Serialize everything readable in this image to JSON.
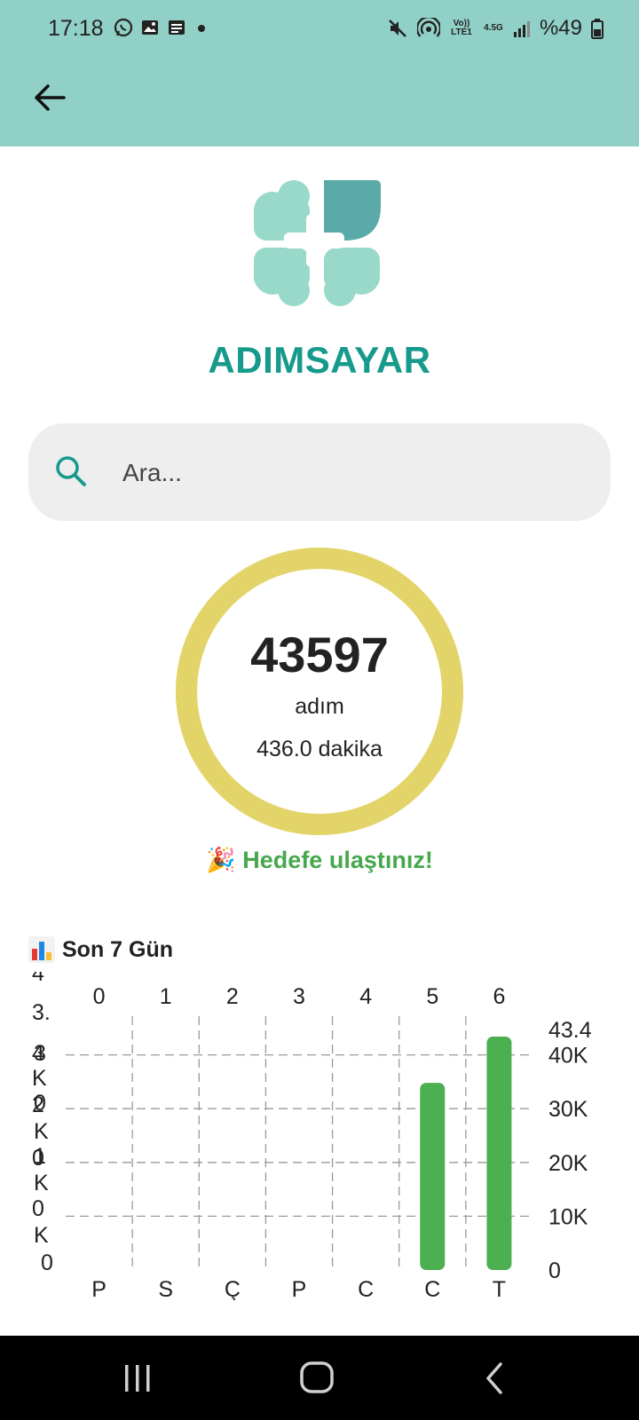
{
  "status_bar": {
    "time": "17:18",
    "left_icons": [
      "whatsapp-icon",
      "gallery-icon",
      "message-icon",
      "dot-icon"
    ],
    "right_icons": [
      "mute-icon",
      "hotspot-icon",
      "volte-icon",
      "signal-icon"
    ],
    "volte_label": "Vo)) LTE1",
    "network_label": "4.5G",
    "battery": "%49"
  },
  "app": {
    "title": "ADIMSAYAR",
    "brand_color": "#169a8c"
  },
  "search": {
    "placeholder": "Ara..."
  },
  "progress": {
    "steps": "43597",
    "unit": "adım",
    "minutes": "436.0 dakika",
    "ring_color": "#e3d46a",
    "goal_fraction": 1.0,
    "goal_message": "🎉 Hedefe ulaştınız!"
  },
  "weekly": {
    "title": "Son 7 Gün"
  },
  "chart_data": {
    "type": "bar",
    "categories": [
      "P",
      "S",
      "Ç",
      "P",
      "C",
      "C",
      "T"
    ],
    "top_labels": [
      "0",
      "1",
      "2",
      "3",
      "4",
      "5",
      "6"
    ],
    "values": [
      0,
      0,
      0,
      0,
      0,
      34800,
      43400
    ],
    "right_ticks": [
      "43.4",
      "40K",
      "30K",
      "20K",
      "10K",
      "0"
    ],
    "left_ticks": [
      "4",
      "3.",
      "4",
      "3",
      "K",
      "0",
      "2",
      "K",
      "0",
      "1",
      "K",
      "0",
      "K",
      "0"
    ],
    "ylim": [
      0,
      43400
    ],
    "grid_values": [
      10000,
      20000,
      30000,
      40000
    ],
    "bar_color": "#4caf50",
    "grid": true
  },
  "nav": {
    "buttons": [
      "recent-apps-icon",
      "home-icon",
      "back-icon"
    ]
  }
}
